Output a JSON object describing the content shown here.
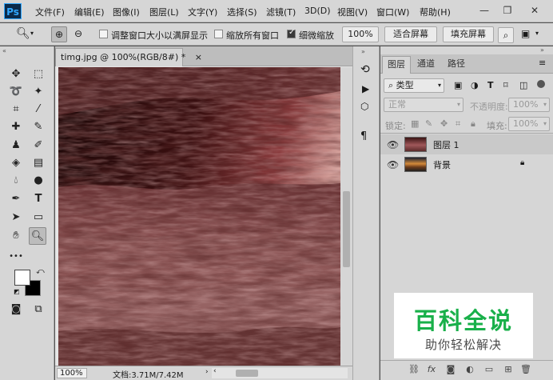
{
  "app": {
    "logo": "Ps"
  },
  "menu": [
    "文件(F)",
    "编辑(E)",
    "图像(I)",
    "图层(L)",
    "文字(Y)",
    "选择(S)",
    "滤镜(T)",
    "3D(D)",
    "视图(V)",
    "窗口(W)",
    "帮助(H)"
  ],
  "options": {
    "cb1_label": "调整窗口大小以满屏显示",
    "cb2_label": "缩放所有窗口",
    "cb3_label": "细微缩放",
    "zoom_value": "100%",
    "fit_label": "适合屏幕",
    "fill_label": "填充屏幕",
    "cb3_checked": true
  },
  "document": {
    "tab_title": "timg.jpg @ 100%(RGB/8#) *",
    "zoom": "100%",
    "doc_info": "文档:3.71M/7.42M"
  },
  "layers_panel": {
    "tabs": [
      "图层",
      "通道",
      "路径"
    ],
    "filter_kind": "类型",
    "blend_mode": "正常",
    "opacity_label": "不透明度:",
    "opacity_value": "100%",
    "lock_label": "锁定:",
    "fill_label": "填充:",
    "fill_value": "100%",
    "layers": [
      {
        "name": "图层 1",
        "selected": true
      },
      {
        "name": "背景",
        "selected": false
      }
    ]
  },
  "watermark": {
    "title": "百科全说",
    "subtitle": "助你轻松解决"
  },
  "colors": {
    "accent_green": "#19b04a",
    "ps_blue": "#31a8ff"
  }
}
